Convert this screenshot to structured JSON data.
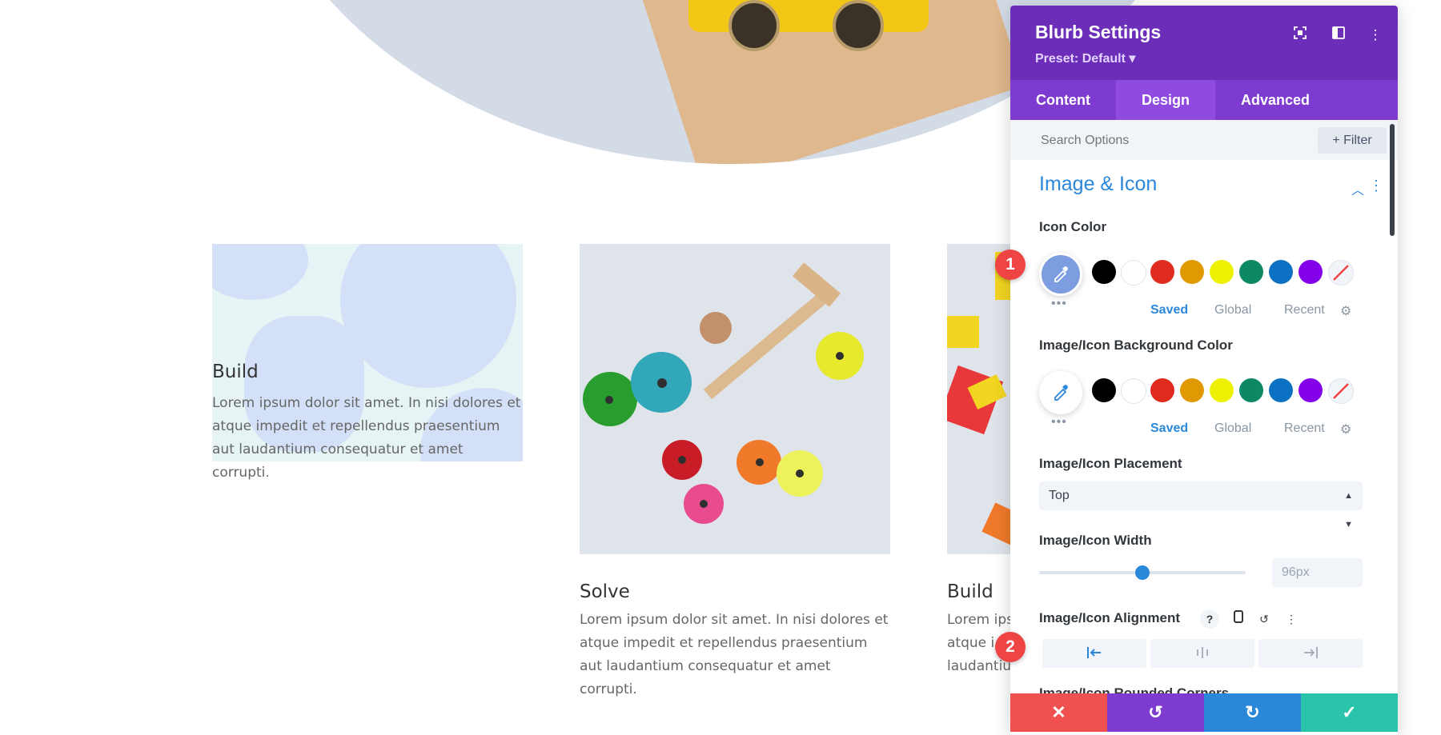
{
  "cards": [
    {
      "title": "Build",
      "text": "Lorem ipsum dolor sit amet. In nisi dolores et atque impedit et repellendus praesentium aut laudantium consequatur et amet corrupti."
    },
    {
      "title": "Solve",
      "text": "Lorem ipsum dolor sit amet. In nisi dolores et atque impedit et repellendus praesentium aut laudantium consequatur et amet corrupti."
    },
    {
      "title": "Build",
      "text_visible": "Lorem ips\natque i\nlaudantiu"
    }
  ],
  "panel": {
    "title": "Blurb Settings",
    "preset": "Preset: Default ▾",
    "tabs": [
      "Content",
      "Design",
      "Advanced"
    ],
    "active_tab": "Design",
    "search_placeholder": "Search Options",
    "filter_label": "+ Filter",
    "section_title": "Image & Icon",
    "icon_color_label": "Icon Color",
    "icon_bg_label": "Image/Icon Background Color",
    "palette_tabs": [
      "Saved",
      "Global",
      "Recent"
    ],
    "placement_label": "Image/Icon Placement",
    "placement_value": "Top",
    "width_label": "Image/Icon Width",
    "width_value": "96px",
    "width_slider_fraction": 0.45,
    "alignment_label": "Image/Icon Alignment",
    "rounded_label": "Image/Icon Rounded Corners",
    "swatches": [
      "#000000",
      "#ffffff",
      "#e02b20",
      "#e09900",
      "#edf000",
      "#0c8964",
      "#0c71c3",
      "#8300e9"
    ],
    "icon_color_selected": "#7c9ee0",
    "accent": "#2b87da",
    "header_color": "#6c2eb9",
    "tab_color": "#7e3bd0",
    "footer_colors": [
      "#ef5050",
      "#7e3bd0",
      "#2b87da",
      "#29c4a9"
    ],
    "footer_icons": [
      "close-icon",
      "undo-icon",
      "redo-icon",
      "check-icon"
    ]
  },
  "markers": [
    "1",
    "2"
  ]
}
